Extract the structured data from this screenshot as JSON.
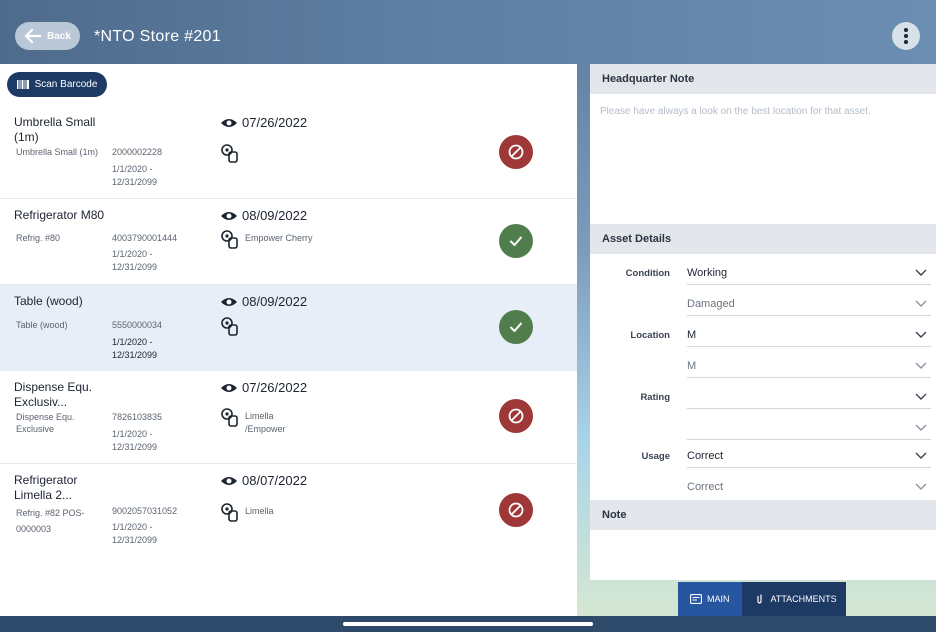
{
  "header": {
    "back_label": "Back",
    "title": "*NTO Store #201",
    "more_icon": "more-vertical-icon"
  },
  "toolbar": {
    "scan_label": "Scan Barcode"
  },
  "assets": [
    {
      "name": "Umbrella Small (1m)",
      "sub": "Umbrella Small (1m)",
      "code": "2000002228",
      "dates": "1/1/2020 - 12/31/2099",
      "date": "07/26/2022",
      "location": "",
      "status": "bad"
    },
    {
      "name": "Refrigerator M80",
      "sub": "Refrig. #80",
      "code": "4003790001444",
      "dates": "1/1/2020 - 12/31/2099",
      "date": "08/09/2022",
      "location": "Empower Cherry",
      "status": "ok"
    },
    {
      "name": "Table (wood)",
      "sub": "Table (wood)",
      "code": "5550000034",
      "dates": "1/1/2020 - 12/31/2099",
      "date": "08/09/2022",
      "location": "",
      "status": "ok"
    },
    {
      "name": "Dispense Equ. Exclusiv...",
      "sub": "Dispense Equ. Exclusive",
      "code": "7826103835",
      "dates": "1/1/2020 - 12/31/2099",
      "date": "07/26/2022",
      "location": "Limella /Empower",
      "status": "bad"
    },
    {
      "name": "Refrigerator Limella 2...",
      "sub": "Refrig. #82 POS-0000003",
      "code": "9002057031052",
      "dates": "1/1/2020 - 12/31/2099",
      "date": "08/07/2022",
      "location": "Limella",
      "status": "bad"
    }
  ],
  "details": {
    "hq_title": "Headquarter Note",
    "hq_note": "Please have always a look on the best location for that asset.",
    "asset_title": "Asset Details",
    "condition_label": "Condition",
    "condition_value": "Working",
    "condition_prev": "Damaged",
    "location_label": "Location",
    "location_value": "M",
    "location_prev": "M",
    "rating_label": "Rating",
    "rating_value": "",
    "rating_prev": "",
    "usage_label": "Usage",
    "usage_value": "Correct",
    "usage_prev": "Correct",
    "note_title": "Note"
  },
  "tabs": {
    "main": "MAIN",
    "attachments": "ATTACHMENTS"
  },
  "colors": {
    "accent": "#1d3a64",
    "ok": "#4f7d4b",
    "bad": "#9e3838",
    "selected": "#e8eef8"
  }
}
